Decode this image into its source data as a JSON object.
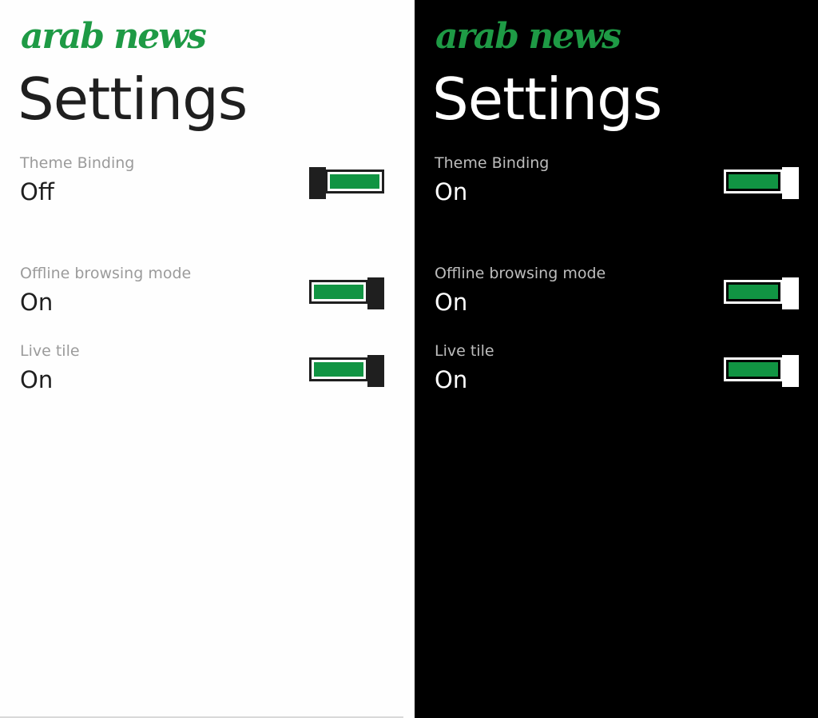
{
  "colors": {
    "accent_green": "#119443",
    "logo_green": "#1e9a45",
    "light_background": "#fefefe",
    "dark_background": "#000000"
  },
  "screens": [
    {
      "theme": "light",
      "logo_text": "arab news",
      "title": "Settings",
      "settings": [
        {
          "label": "Theme Binding",
          "value": "Off",
          "enabled": false
        },
        {
          "label": "Offline browsing mode",
          "value": "On",
          "enabled": true
        },
        {
          "label": "Live tile",
          "value": "On",
          "enabled": true
        }
      ]
    },
    {
      "theme": "dark",
      "logo_text": "arab news",
      "title": "Settings",
      "settings": [
        {
          "label": "Theme Binding",
          "value": "On",
          "enabled": true
        },
        {
          "label": "Offline browsing mode",
          "value": "On",
          "enabled": true
        },
        {
          "label": "Live tile",
          "value": "On",
          "enabled": true
        }
      ]
    }
  ]
}
